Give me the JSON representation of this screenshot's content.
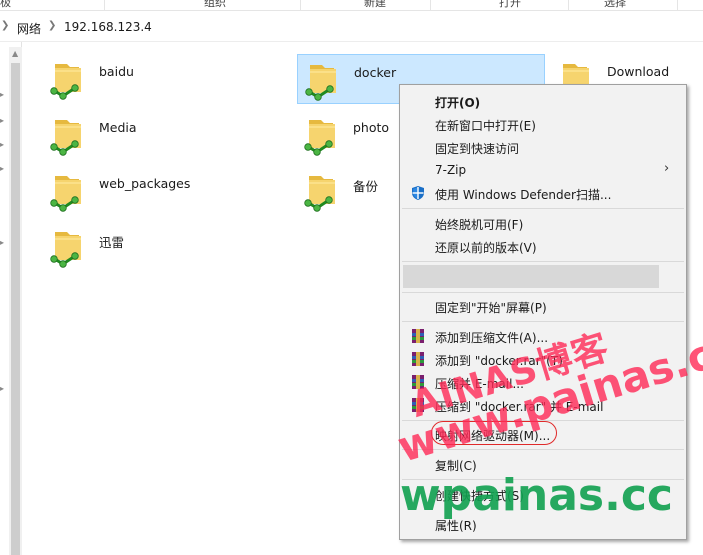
{
  "ribbon": {
    "labels": [
      "极",
      "组织",
      "新建",
      "打开",
      "选择"
    ]
  },
  "address": {
    "crumbs": [
      "网络",
      "192.168.123.4"
    ]
  },
  "items": [
    {
      "label": "baidu",
      "selected": false
    },
    {
      "label": "docker",
      "selected": true
    },
    {
      "label": "Download",
      "selected": false
    },
    {
      "label": "Media",
      "selected": false
    },
    {
      "label": "photo",
      "selected": false
    },
    {
      "label": "web_packages",
      "selected": false
    },
    {
      "label": "备份",
      "selected": false
    },
    {
      "label": "迅雷",
      "selected": false
    }
  ],
  "context_menu": {
    "items": [
      "打开(O)",
      "在新窗口中打开(E)",
      "固定到快速访问",
      "7-Zip",
      "使用 Windows Defender扫描...",
      "始终脱机可用(F)",
      "还原以前的版本(V)",
      "固定到\"开始\"屏幕(P)",
      "添加到压缩文件(A)...",
      "添加到 \"docker.rar\"(T)",
      "压缩并 E-mail...",
      "压缩到 \"docker.rar\" 并 E-mail",
      "映射网络驱动器(M)...",
      "复制(C)",
      "创建快捷方式(S)",
      "属性(R)"
    ]
  },
  "watermarks": [
    "AINAS博客",
    "www.painas.cc",
    "wpainas.cc"
  ],
  "colors": {
    "selection": "#cce8ff",
    "highlight_oval": "#e02a2a",
    "watermark_red": "#ff2a56",
    "watermark_green": "#10a050"
  }
}
